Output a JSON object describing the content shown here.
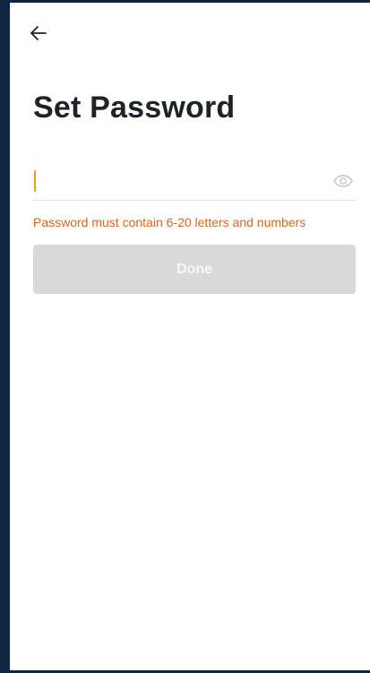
{
  "header": {
    "back_icon": "arrow-left-icon"
  },
  "page": {
    "title": "Set Password"
  },
  "password_field": {
    "value": "",
    "placeholder": "",
    "toggle_icon": "eye-icon",
    "caret_color": "#f0a020"
  },
  "hint": {
    "text": "Password must contain 6-20 letters and numbers",
    "color": "#d9661c"
  },
  "actions": {
    "done_label": "Done",
    "done_disabled_bg": "#d9d9d9"
  },
  "colors": {
    "outer_frame": "#0f2440",
    "background": "#ffffff"
  }
}
